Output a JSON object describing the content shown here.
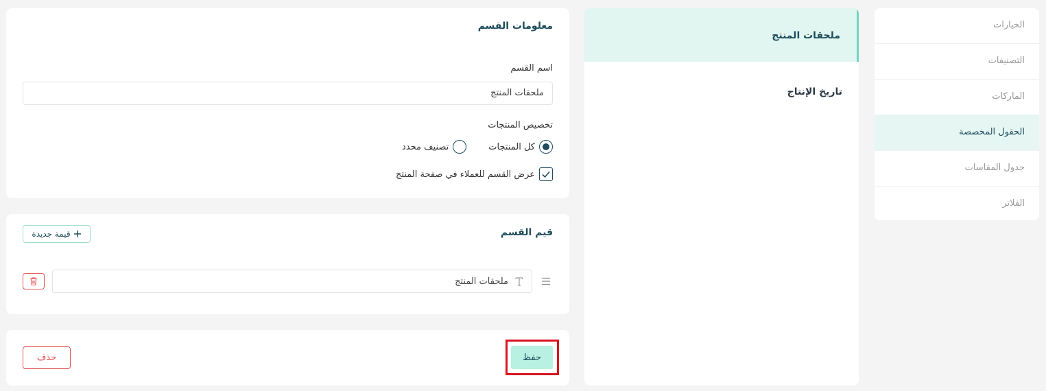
{
  "sidebar": {
    "items": [
      {
        "label": "الخيارات"
      },
      {
        "label": "التصنيفات"
      },
      {
        "label": "الماركات"
      },
      {
        "label": "الحقول المخصصة"
      },
      {
        "label": "جدول المقاسات"
      },
      {
        "label": "الفلاتر"
      }
    ],
    "active_index": 3
  },
  "sections_list": {
    "items": [
      {
        "label": "ملحقات المنتج"
      },
      {
        "label": "تاريخ الإنتاج"
      }
    ]
  },
  "section_info": {
    "title": "معلومات القسم",
    "name_label": "اسم القسم",
    "name_value": "ملحقات المنتج",
    "assign_label": "تخصيص المنتجات",
    "radio_all": "كل المنتجات",
    "radio_category": "تصنيف محدد",
    "show_customers_label": "عرض القسم للعملاء في صفحة المنتج"
  },
  "section_values": {
    "title": "قيم القسم",
    "new_value_label": "قيمة جديدة",
    "values": [
      {
        "text": "ملحقات المنتج"
      }
    ]
  },
  "actions": {
    "save_label": "حفظ",
    "delete_label": "حذف"
  },
  "colors": {
    "accent": "#1d4d5c",
    "active_bg": "#e1f6f1",
    "save_bg": "#b8f0e2",
    "danger": "#e25252",
    "highlight": "#d9141e"
  },
  "icons": {
    "add": "plus-icon",
    "delete": "trash-icon",
    "text_type": "text-type-icon",
    "drag": "drag-handle-icon",
    "check": "check-icon"
  }
}
